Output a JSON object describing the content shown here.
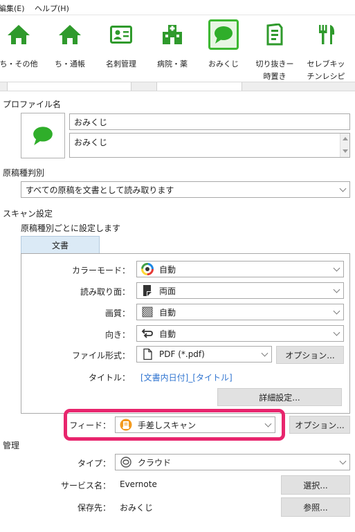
{
  "menu": {
    "edit": "編集(E)",
    "help": "ヘルプ(H)"
  },
  "toolbar": {
    "items": [
      {
        "label": "ち・その他",
        "icon": "home-icon"
      },
      {
        "label": "ち・通帳",
        "icon": "home-icon"
      },
      {
        "label": "名刺管理",
        "icon": "business-card-icon"
      },
      {
        "label": "病院・薬",
        "icon": "hospital-icon"
      },
      {
        "label": "おみくじ",
        "icon": "speech-bubble-icon",
        "selected": true
      },
      {
        "label": "切り抜きー\n時置き",
        "icon": "clipping-icon"
      },
      {
        "label": "セレブキッ\nチンレシピ",
        "icon": "fork-knife-icon"
      }
    ],
    "accent": "#3db832"
  },
  "profile": {
    "section_label": "プロファイル名",
    "name_value": "おみくじ",
    "comment_value": "おみくじ",
    "icon": "speech-bubble-icon",
    "icon_color": "#2fae2a"
  },
  "doc_type": {
    "section_label": "原稿種判別",
    "value": "すべての原稿を文書として読み取ります"
  },
  "scan": {
    "section_label": "スキャン設定",
    "sub_label": "原稿種別ごとに設定します",
    "tab_label": "文書",
    "color_mode_label": "カラーモード：",
    "color_mode_value": "自動",
    "side_label": "読み取り面：",
    "side_value": "両面",
    "quality_label": "画質：",
    "quality_value": "自動",
    "orientation_label": "向き：",
    "orientation_value": "自動",
    "file_format_label": "ファイル形式：",
    "file_format_value": "PDF (*.pdf)",
    "options_label": "オプション...",
    "title_label": "タイトル：",
    "title_value": "[文書内日付]_[タイトル]",
    "title_color": "#2f74d0",
    "details_label": "詳細設定...",
    "feed_label": "フィード：",
    "feed_value": "手差しスキャン",
    "feed_options_label": "オプション...",
    "highlight_color": "#e8256d"
  },
  "manage": {
    "section_label": "管理",
    "type_label": "タイプ：",
    "type_value": "クラウド",
    "service_label": "サービス名：",
    "service_value": "Evernote",
    "select_label": "選択...",
    "dest_label": "保存先：",
    "dest_value": "おみくじ",
    "browse_label": "参照..."
  }
}
